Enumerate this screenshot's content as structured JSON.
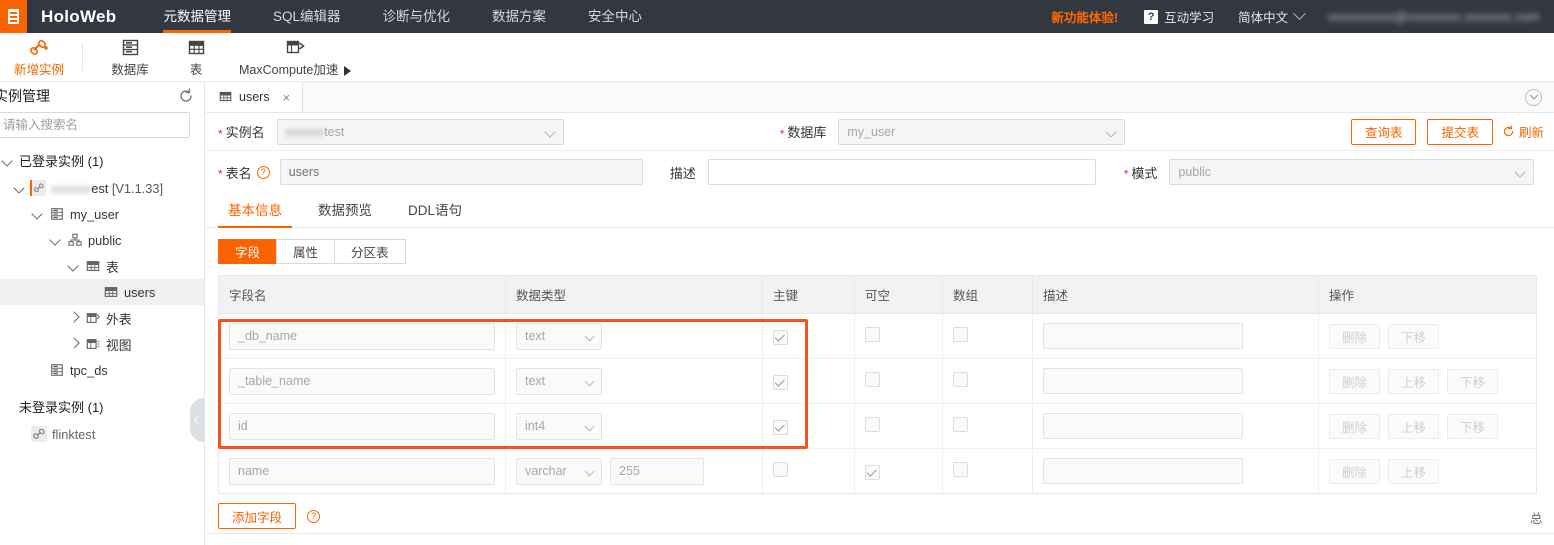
{
  "topnav": {
    "brand": "HoloWeb",
    "items": [
      {
        "label": "元数据管理",
        "active": true
      },
      {
        "label": "SQL编辑器",
        "active": false
      },
      {
        "label": "诊断与优化",
        "active": false
      },
      {
        "label": "数据方案",
        "active": false
      },
      {
        "label": "安全中心",
        "active": false
      }
    ],
    "promo": "新功能体验!",
    "help_badge": "?",
    "help_label": "互动学习",
    "lang_label": "简体中文",
    "user_label": "xxxxxxxxxx@xxxxxxxx.xxxxxxx.com",
    "accent": "#fa6400",
    "bg": "#333840"
  },
  "toolbar": {
    "items": [
      {
        "label": "新增实例",
        "icon": "link-plus-icon",
        "accent": true
      },
      {
        "label": "数据库",
        "icon": "database-icon",
        "accent": false
      },
      {
        "label": "表",
        "icon": "table-icon",
        "accent": false
      },
      {
        "label": "MaxCompute加速",
        "icon": "accelerate-icon",
        "accent": false
      }
    ]
  },
  "sidebar": {
    "title": "实例管理",
    "refresh_icon": "refresh-icon",
    "search_placeholder": "请输入搜索名",
    "search_value": "",
    "groups": [
      {
        "label": "已登录实例 (1)"
      },
      {
        "label": "未登录实例 (1)"
      }
    ],
    "tree": [
      {
        "label": "",
        "blurred": "xxxxxx",
        "suffix": "est",
        "version": "[V1.1.33]",
        "icon": "instance-icon",
        "depth": 1,
        "twisty": "down",
        "selected": false
      },
      {
        "label": "my_user",
        "icon": "database-icon",
        "depth": 2,
        "twisty": "down",
        "selected": false
      },
      {
        "label": "public",
        "icon": "schema-icon",
        "depth": 3,
        "twisty": "down",
        "selected": false
      },
      {
        "label": "表",
        "icon": "table-icon",
        "depth": 4,
        "twisty": "down",
        "selected": false
      },
      {
        "label": "users",
        "icon": "table-icon",
        "depth": 5,
        "twisty": "none",
        "selected": true
      },
      {
        "label": "外表",
        "icon": "foreign-table-icon",
        "depth": 4,
        "twisty": "right",
        "selected": false
      },
      {
        "label": "视图",
        "icon": "view-icon",
        "depth": 4,
        "twisty": "right",
        "selected": false
      },
      {
        "label": "tpc_ds",
        "icon": "database-icon",
        "depth": 2,
        "twisty": "none",
        "selected": false
      }
    ],
    "unlogged": [
      {
        "label": "flinktest",
        "icon": "instance-icon",
        "depth": 1
      }
    ],
    "collapse_icon": "chevron-left-icon"
  },
  "main": {
    "tab": {
      "label": "users",
      "icon": "table-icon",
      "close": "×"
    },
    "collapse_icon": "chevron-down-circle-icon",
    "form": {
      "instance_label": "实例名",
      "instance_value_blur": "xxxxxx",
      "instance_value_suffix": "test",
      "database_label": "数据库",
      "database_value": "my_user",
      "tablename_label": "表名",
      "tablename_placeholder": "users",
      "desc_label": "描述",
      "desc_value": "",
      "schema_label": "模式",
      "schema_value": "public",
      "query_button": "查询表",
      "submit_button": "提交表",
      "refresh_link": "刷新"
    },
    "tabs": [
      {
        "label": "基本信息",
        "active": true
      },
      {
        "label": "数据预览",
        "active": false
      },
      {
        "label": "DDL语句",
        "active": false
      }
    ],
    "segments": [
      {
        "label": "字段",
        "active": true
      },
      {
        "label": "属性",
        "active": false
      },
      {
        "label": "分区表",
        "active": false
      }
    ],
    "add_field_button": "添加字段",
    "add_field_help": "?",
    "total_text": "总"
  },
  "grid": {
    "columns": [
      "字段名",
      "数据类型",
      "主键",
      "可空",
      "数组",
      "描述",
      "操作"
    ],
    "op_labels": {
      "delete": "删除",
      "up": "上移",
      "down": "下移"
    },
    "rows": [
      {
        "name": "_db_name",
        "type": "text",
        "length": "",
        "primary_key": true,
        "nullable": false,
        "array": false,
        "description": "",
        "ops": [
          "删除",
          "下移"
        ],
        "highlighted": true
      },
      {
        "name": "_table_name",
        "type": "text",
        "length": "",
        "primary_key": true,
        "nullable": false,
        "array": false,
        "description": "",
        "ops": [
          "删除",
          "上移",
          "下移"
        ],
        "highlighted": true
      },
      {
        "name": "id",
        "type": "int4",
        "length": "",
        "primary_key": true,
        "nullable": false,
        "array": false,
        "description": "",
        "ops": [
          "删除",
          "上移",
          "下移"
        ],
        "highlighted": true
      },
      {
        "name": "name",
        "type": "varchar",
        "length": "255",
        "primary_key": false,
        "nullable": true,
        "array": false,
        "description": "",
        "ops": [
          "删除",
          "上移"
        ],
        "highlighted": false
      }
    ]
  }
}
